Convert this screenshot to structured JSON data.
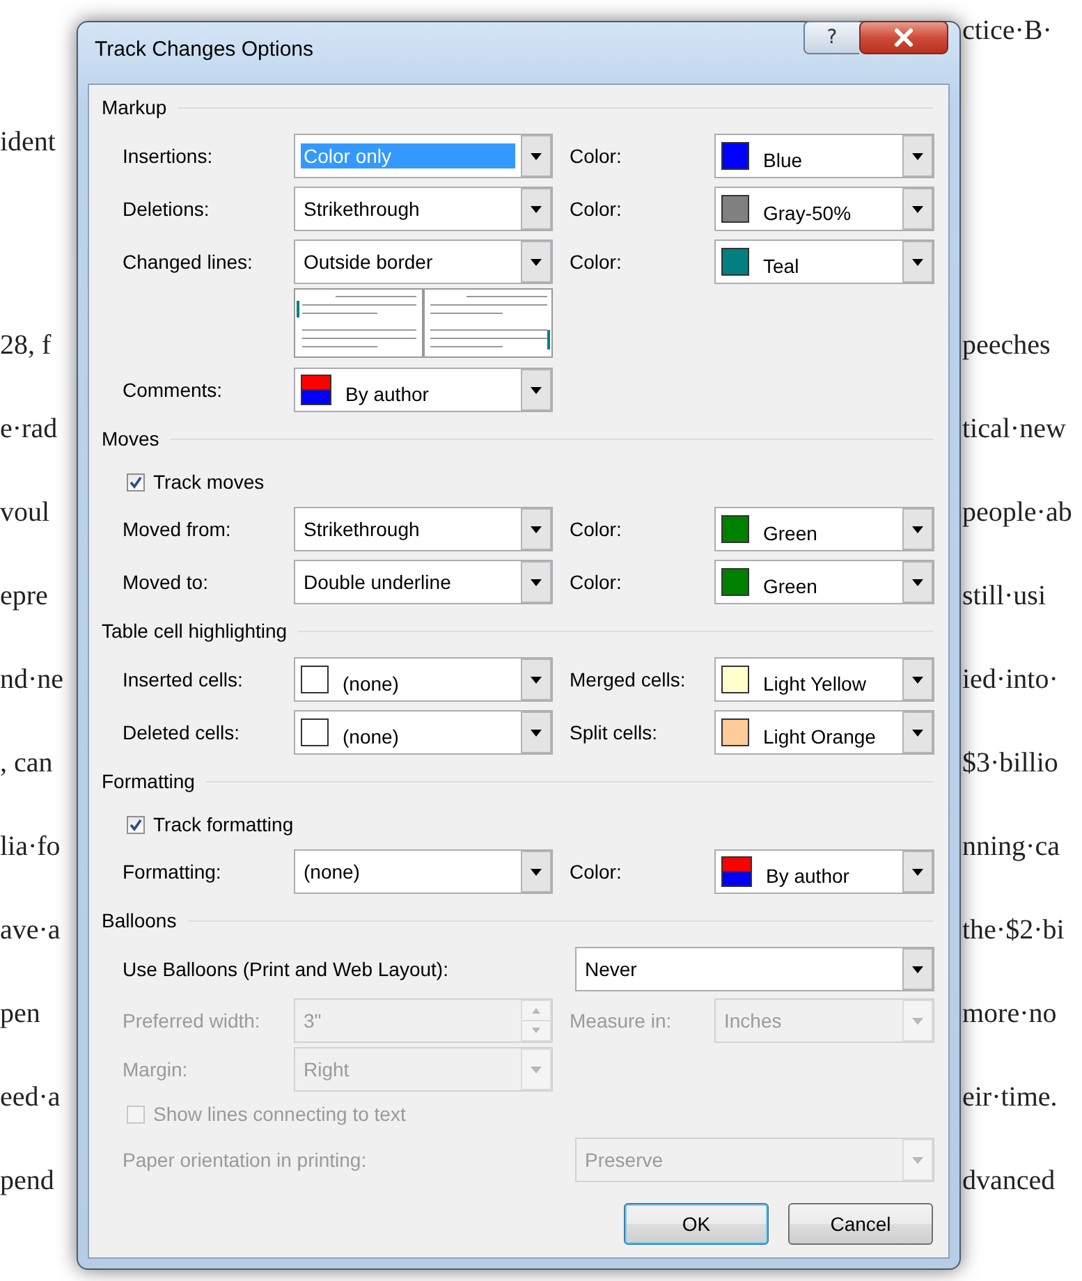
{
  "document": {
    "rows": [
      {
        "right": "ctice·B·"
      },
      {
        "left": "ident"
      },
      {
        "left": "28, f",
        "right": "peeches"
      },
      {
        "left": "e·rad",
        "right": "tical·new"
      },
      {
        "left": "voul",
        "right": "people·ab"
      },
      {
        "left": "epre",
        "right": "still·usi"
      },
      {
        "left": "nd·ne",
        "right": "ied·into·"
      },
      {
        "left": ", can",
        "right": "$3·billio"
      },
      {
        "left": "lia·fo",
        "right": "nning·ca"
      },
      {
        "left": "ave·a",
        "right": "the·$2·bi"
      },
      {
        "left": "pen",
        "right": "more·no"
      },
      {
        "left": "eed·a",
        "right": "eir·time."
      },
      {
        "left": "pend",
        "right": "dvanced"
      }
    ]
  },
  "dialog": {
    "title": "Track Changes Options",
    "help_button": "?",
    "sections": [
      {
        "title": "Markup",
        "rows": [
          {
            "kind": "grid",
            "disabled": false,
            "cells": [
              {
                "kind": "label",
                "text": "Insertions:"
              },
              {
                "kind": "select",
                "value": "Color only",
                "selected": true
              },
              {
                "kind": "label",
                "text": "Color:"
              },
              {
                "kind": "select",
                "value": "Blue",
                "selected": false,
                "swatch": {
                  "kind": "solid",
                  "color": "#0000ff"
                }
              }
            ]
          },
          {
            "kind": "grid",
            "disabled": false,
            "cells": [
              {
                "kind": "label",
                "text": "Deletions:"
              },
              {
                "kind": "select",
                "value": "Strikethrough",
                "selected": false
              },
              {
                "kind": "label",
                "text": "Color:"
              },
              {
                "kind": "select",
                "value": "Gray-50%",
                "selected": false,
                "swatch": {
                  "kind": "solid",
                  "color": "#808080"
                }
              }
            ]
          },
          {
            "kind": "grid",
            "disabled": false,
            "cells": [
              {
                "kind": "label",
                "text": "Changed lines:"
              },
              {
                "kind": "select",
                "value": "Outside border",
                "selected": false
              },
              {
                "kind": "label",
                "text": "Color:"
              },
              {
                "kind": "select",
                "value": "Teal",
                "selected": false,
                "swatch": {
                  "kind": "solid",
                  "color": "#008080"
                }
              }
            ]
          },
          {
            "kind": "preview"
          },
          {
            "kind": "grid",
            "disabled": false,
            "cells": [
              {
                "kind": "label",
                "text": "Comments:"
              },
              {
                "kind": "select",
                "value": "By author",
                "selected": false,
                "swatch": {
                  "kind": "author"
                }
              }
            ]
          }
        ]
      },
      {
        "title": "Moves",
        "rows": [
          {
            "kind": "checkbox",
            "label": "Track moves",
            "checked": true,
            "disabled": false
          },
          {
            "kind": "grid",
            "disabled": false,
            "cells": [
              {
                "kind": "label",
                "text": "Moved from:"
              },
              {
                "kind": "select",
                "value": "Strikethrough",
                "selected": false
              },
              {
                "kind": "label",
                "text": "Color:"
              },
              {
                "kind": "select",
                "value": "Green",
                "selected": false,
                "swatch": {
                  "kind": "solid",
                  "color": "#008000"
                }
              }
            ]
          },
          {
            "kind": "grid",
            "disabled": false,
            "cells": [
              {
                "kind": "label",
                "text": "Moved to:"
              },
              {
                "kind": "select",
                "value": "Double underline",
                "selected": false
              },
              {
                "kind": "label",
                "text": "Color:"
              },
              {
                "kind": "select",
                "value": "Green",
                "selected": false,
                "swatch": {
                  "kind": "solid",
                  "color": "#008000"
                }
              }
            ]
          }
        ]
      },
      {
        "title": "Table cell highlighting",
        "rows": [
          {
            "kind": "grid",
            "disabled": false,
            "cells": [
              {
                "kind": "label",
                "text": "Inserted cells:"
              },
              {
                "kind": "select",
                "value": "(none)",
                "selected": false,
                "swatch": {
                  "kind": "empty"
                }
              },
              {
                "kind": "label",
                "text": "Merged cells:"
              },
              {
                "kind": "select",
                "value": "Light Yellow",
                "selected": false,
                "swatch": {
                  "kind": "solid",
                  "color": "#ffffcc"
                }
              }
            ]
          },
          {
            "kind": "grid",
            "disabled": false,
            "cells": [
              {
                "kind": "label",
                "text": "Deleted cells:"
              },
              {
                "kind": "select",
                "value": "(none)",
                "selected": false,
                "swatch": {
                  "kind": "empty"
                }
              },
              {
                "kind": "label",
                "text": "Split cells:"
              },
              {
                "kind": "select",
                "value": "Light Orange",
                "selected": false,
                "swatch": {
                  "kind": "solid",
                  "color": "#ffcc99"
                }
              }
            ]
          }
        ]
      },
      {
        "title": "Formatting",
        "rows": [
          {
            "kind": "checkbox",
            "label": "Track formatting",
            "checked": true,
            "disabled": false
          },
          {
            "kind": "grid",
            "disabled": false,
            "cells": [
              {
                "kind": "label",
                "text": "Formatting:"
              },
              {
                "kind": "select",
                "value": "(none)",
                "selected": false
              },
              {
                "kind": "label",
                "text": "Color:"
              },
              {
                "kind": "select",
                "value": "By author",
                "selected": false,
                "swatch": {
                  "kind": "author"
                }
              }
            ]
          }
        ]
      },
      {
        "title": "Balloons",
        "rows": [
          {
            "kind": "wide",
            "disabled": false,
            "cells": [
              {
                "kind": "label",
                "text": "Use Balloons (Print and Web Layout):"
              },
              {
                "kind": "select",
                "value": "Never",
                "selected": false
              }
            ]
          },
          {
            "kind": "grid",
            "disabled": true,
            "cells": [
              {
                "kind": "label",
                "text": "Preferred width:"
              },
              {
                "kind": "spin",
                "value": "3\""
              },
              {
                "kind": "label",
                "text": "Measure in:"
              },
              {
                "kind": "select",
                "value": "Inches",
                "selected": false
              }
            ]
          },
          {
            "kind": "grid",
            "disabled": true,
            "cells": [
              {
                "kind": "label",
                "text": "Margin:"
              },
              {
                "kind": "select",
                "value": "Right",
                "selected": false
              }
            ]
          },
          {
            "kind": "checkbox",
            "label": "Show lines connecting to text",
            "checked": false,
            "disabled": true
          },
          {
            "kind": "wide",
            "disabled": true,
            "cells": [
              {
                "kind": "label",
                "text": "Paper orientation in printing:"
              },
              {
                "kind": "select",
                "value": "Preserve",
                "selected": false
              }
            ]
          }
        ]
      }
    ],
    "buttons": [
      {
        "label": "OK",
        "default": true
      },
      {
        "label": "Cancel",
        "default": false
      }
    ]
  }
}
